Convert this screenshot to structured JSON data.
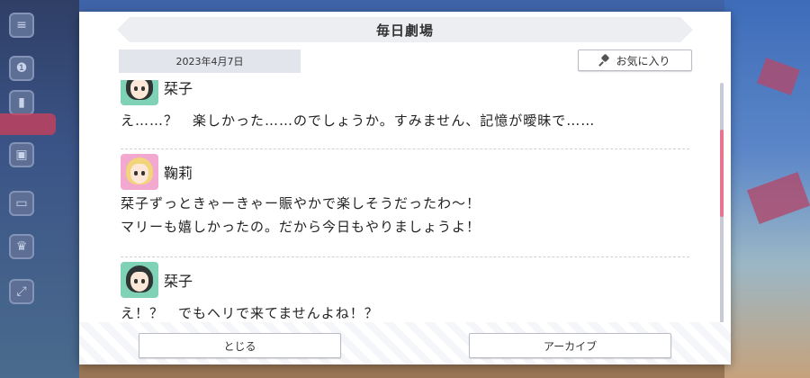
{
  "dialog": {
    "title": "毎日劇場",
    "date": "2023年4月7日",
    "favorite_label": "お気に入り"
  },
  "messages": [
    {
      "speaker": "栞子",
      "avatar": "green",
      "lines": [
        "え……？　楽しかった……のでしょうか。すみません、記憶が曖昧で……"
      ]
    },
    {
      "speaker": "鞠莉",
      "avatar": "pink",
      "lines": [
        "栞子ずっときゃーきゃー賑やかで楽しそうだったわ～！",
        "マリーも嬉しかったの。だから今日もやりましょうよ！"
      ]
    },
    {
      "speaker": "栞子",
      "avatar": "green",
      "lines": [
        "え！？　でもヘリで来てませんよね！？"
      ]
    }
  ],
  "scroll": {
    "position_fraction": 0.3,
    "visible_fraction": 0.36
  },
  "footer": {
    "close_label": "とじる",
    "archive_label": "アーカイブ"
  },
  "colors": {
    "accent_scroll": "#e8758f",
    "avatar_green": "#7fd2b6",
    "avatar_pink": "#f3a8cf"
  }
}
